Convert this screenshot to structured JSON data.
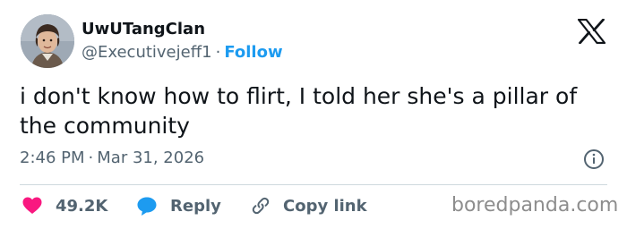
{
  "author": {
    "display_name": "UwUTangClan",
    "handle": "@Executivejeff1",
    "separator": "·",
    "follow_label": "Follow"
  },
  "tweet": {
    "text": "i don't know how to flirt, I told her she's a pillar of the community",
    "time": "2:46 PM",
    "separator": "·",
    "date": "Mar 31, 2026"
  },
  "actions": {
    "likes": "49.2K",
    "reply_label": "Reply",
    "copy_link_label": "Copy link"
  },
  "watermark": "boredpanda.com",
  "icons": {
    "platform": "x-logo-icon",
    "info": "info-icon",
    "like": "heart-icon",
    "reply": "speech-bubble-icon",
    "copy": "link-icon"
  },
  "colors": {
    "text": "#0f1419",
    "secondary": "#536471",
    "follow": "#1d9bf0",
    "like": "#f91880",
    "reply": "#1d9bf0",
    "divider": "#cfd9de",
    "watermark": "#8d8d8d"
  }
}
